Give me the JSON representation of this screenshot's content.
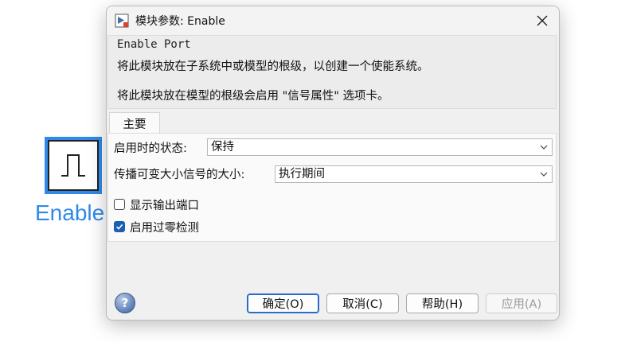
{
  "block": {
    "label": "Enable"
  },
  "dialog": {
    "title": "模块参数: Enable",
    "description": {
      "heading": "Enable Port",
      "line1": "将此模块放在子系统中或模型的根级，以创建一个使能系统。",
      "line2": "将此模块放在模型的根级会启用 \"信号属性\" 选项卡。"
    },
    "tabs": [
      {
        "label": "主要"
      }
    ],
    "params": {
      "state_label": "启用时的状态:",
      "state_value": "保持",
      "propagate_label": "传播可变大小信号的大小:",
      "propagate_value": "执行期间",
      "show_output_label": "显示输出端口",
      "show_output_checked": false,
      "zero_cross_label": "启用过零检测",
      "zero_cross_checked": true
    },
    "buttons": {
      "help": "?",
      "ok": "确定(O)",
      "cancel": "取消(C)",
      "help_btn": "帮助(H)",
      "apply": "应用(A)"
    }
  },
  "colors": {
    "accent": "#2f89e8",
    "checkbox": "#1a5fb4"
  }
}
